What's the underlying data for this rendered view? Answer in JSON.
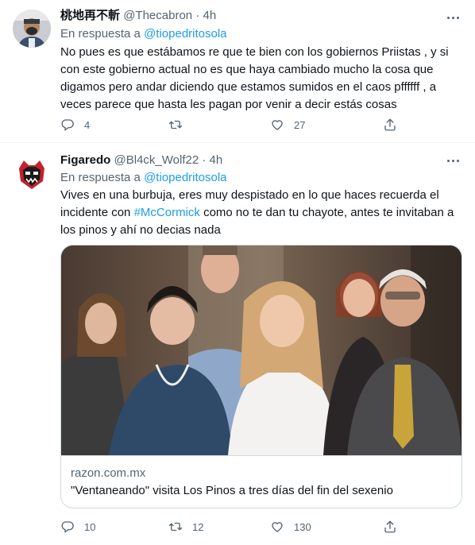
{
  "tweets": [
    {
      "display_name": "桃地再不斬",
      "handle": "@Thecabron",
      "separator": "·",
      "time": "4h",
      "reply_prefix": "En respuesta a",
      "reply_to": "@tiopedritosola",
      "text": "No pues es que estábamos re que te bien con los gobiernos Priistas , y si con este gobierno actual no es que haya cambiado mucho la cosa que digamos pero andar diciendo que estamos sumidos en el caos pffffff , a veces parece que hasta les pagan por venir a decir estás cosas",
      "replies": "4",
      "retweets": "",
      "likes": "27"
    },
    {
      "display_name": "Figaredo",
      "handle": "@Bl4ck_Wolf22",
      "separator": "·",
      "time": "4h",
      "reply_prefix": "En respuesta a",
      "reply_to": "@tiopedritosola",
      "text_part1": "Vives en una burbuja, eres muy despistado en lo que haces recuerda  el incidente con ",
      "hashtag": "#McCormick",
      "text_part2": " como no te dan tu chayote, antes te invitaban a los pinos y ahí no decias nada",
      "card": {
        "domain": "razon.com.mx",
        "title": "\"Ventaneando\" visita Los Pinos a tres días del fin del sexenio"
      },
      "replies": "10",
      "retweets": "12",
      "likes": "130"
    }
  ],
  "colors": {
    "link": "#1d9bf0",
    "secondary_text": "#536471",
    "primary_text": "#0f1419",
    "border": "#cfd9de"
  },
  "icons": [
    "more-icon",
    "reply-icon",
    "retweet-icon",
    "like-icon",
    "share-icon"
  ]
}
